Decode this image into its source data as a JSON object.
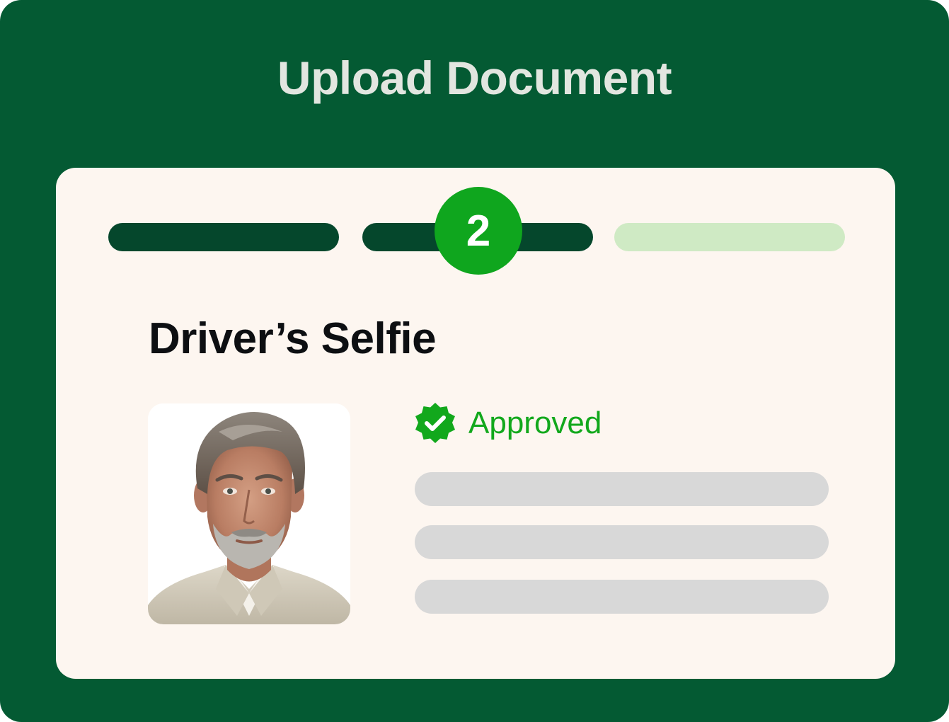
{
  "header": {
    "title": "Upload Document"
  },
  "progress": {
    "current_step_label": "2",
    "current_step": 2,
    "total_steps": 3,
    "colors": {
      "completed": "#05472c",
      "pending": "#cfeac4",
      "badge": "#0fa61e"
    }
  },
  "section": {
    "title": "Driver’s Selfie"
  },
  "selfie": {
    "image": "portrait-photo"
  },
  "status": {
    "label": "Approved",
    "icon": "verified-badge-check-icon",
    "color": "#12a81c"
  },
  "colors": {
    "background": "#045a33",
    "card": "#fdf6f0",
    "title_text": "#e2e6e0",
    "placeholder": "#d8d8d8"
  }
}
